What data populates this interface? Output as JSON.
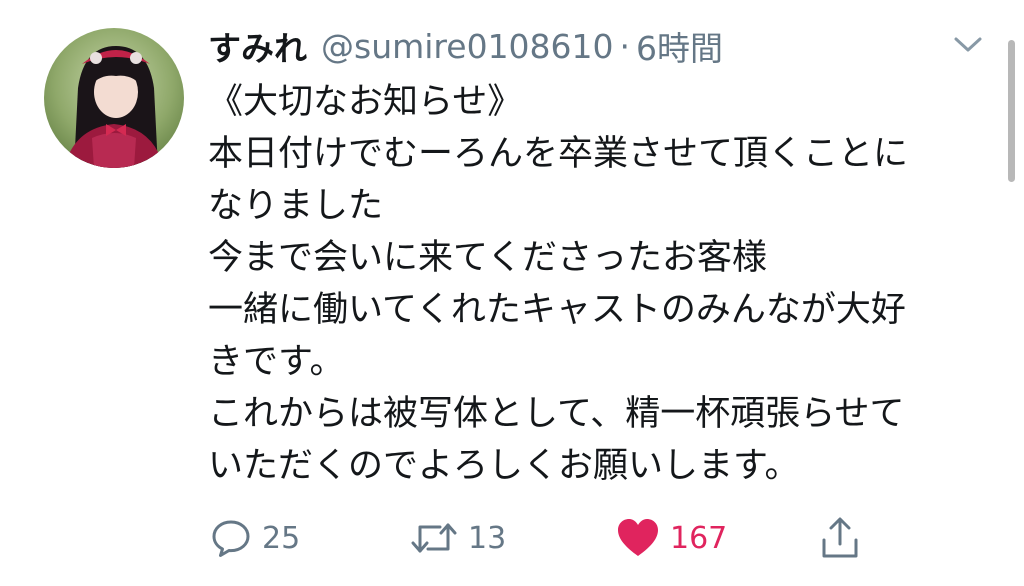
{
  "tweet": {
    "display_name": "すみれ",
    "handle": "@sumire0108610",
    "separator": "·",
    "time": "6時間",
    "lines": [
      "《大切なお知らせ》",
      "本日付けでむーろんを卒業させて頂くことに",
      "なりました",
      "今まで会いに来てくださったお客様",
      "一緒に働いてくれたキャストのみんなが大好",
      "きです。",
      "これからは被写体として、精一杯頑張らせて",
      "いただくのでよろしくお願いします。"
    ]
  },
  "actions": {
    "reply": {
      "icon": "reply-icon",
      "count": "25"
    },
    "retweet": {
      "icon": "retweet-icon",
      "count": "13"
    },
    "like": {
      "icon": "heart-icon",
      "count": "167",
      "color": "#e0245e"
    },
    "share": {
      "icon": "share-icon"
    }
  },
  "colors": {
    "text": "#14171a",
    "secondary": "#657786",
    "like": "#e0245e"
  }
}
